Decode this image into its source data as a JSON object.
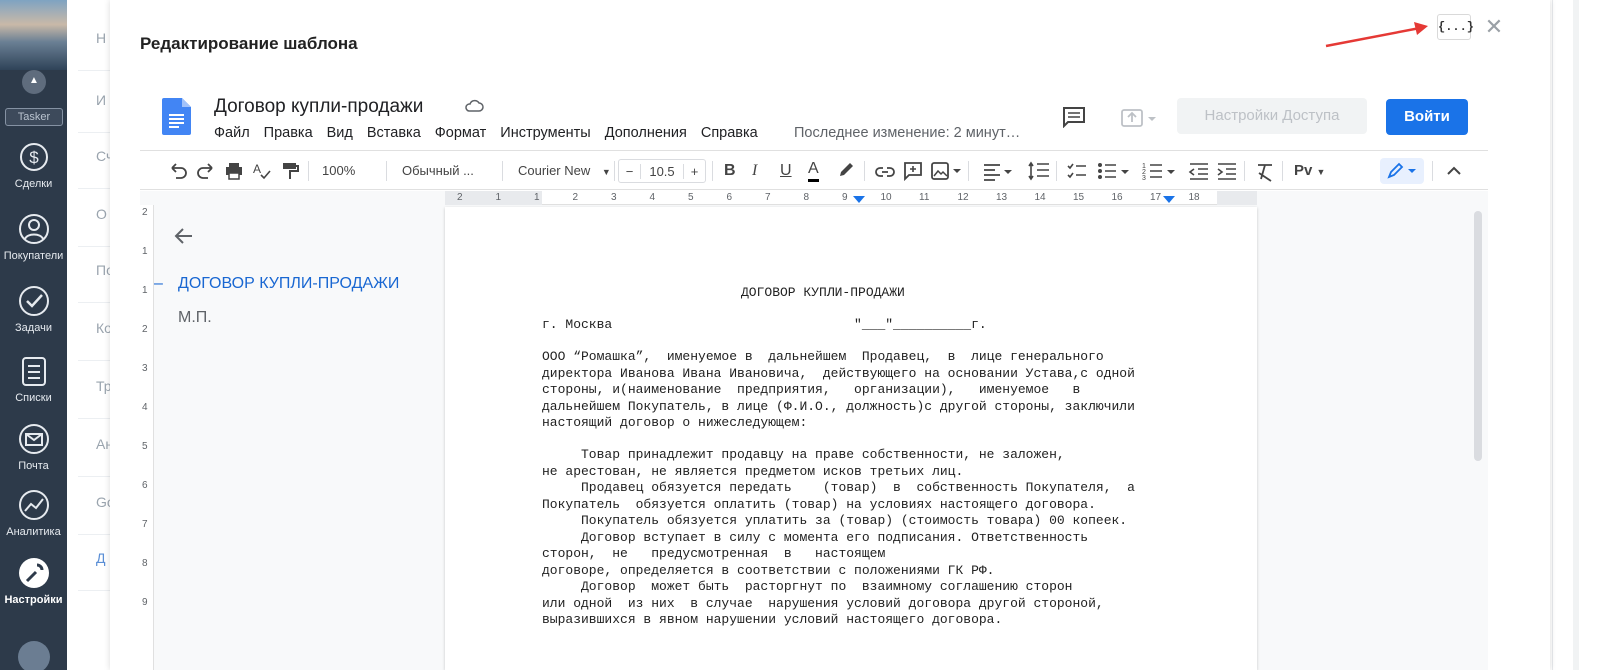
{
  "app": {
    "tasker_label": "Tasker",
    "nav": [
      {
        "label": "Сделки",
        "icon": "dollar-icon"
      },
      {
        "label": "Покупатели",
        "icon": "users-icon"
      },
      {
        "label": "Задачи",
        "icon": "check-icon"
      },
      {
        "label": "Списки",
        "icon": "list-icon"
      },
      {
        "label": "Почта",
        "icon": "mail-icon"
      },
      {
        "label": "Аналитика",
        "icon": "analytics-icon"
      },
      {
        "label": "Настройки",
        "icon": "wrench-icon",
        "active": true
      }
    ],
    "background_rows": [
      "Н",
      "И",
      "Сч",
      "О",
      "По",
      "Ко",
      "Тр",
      "Ан",
      "Go",
      "Д"
    ]
  },
  "modal": {
    "title": "Редактирование шаблона",
    "variables_button": "{...}",
    "close_label": "✕"
  },
  "docs": {
    "title": "Договор купли-продажи",
    "menus": [
      "Файл",
      "Правка",
      "Вид",
      "Вставка",
      "Формат",
      "Инструменты",
      "Дополнения",
      "Справка"
    ],
    "last_edit": "Последнее изменение: 2 минут…",
    "access_button": "Настройки Доступа",
    "login_button": "Войти",
    "accent_color": "#1a73e8"
  },
  "toolbar": {
    "zoom": "100%",
    "style": "Обычный ...",
    "font": "Courier New",
    "font_size": "10.5",
    "minus": "−",
    "plus": "+",
    "bold": "B",
    "italic": "I",
    "underline": "U",
    "text_color": "A",
    "input_tools": "Pv"
  },
  "ruler": {
    "h_ticks": [
      "2",
      "1",
      "1",
      "2",
      "3",
      "4",
      "5",
      "6",
      "7",
      "8",
      "9",
      "10",
      "11",
      "12",
      "13",
      "14",
      "15",
      "16",
      "17",
      "18"
    ],
    "v_ticks": [
      "2",
      "1",
      "1",
      "2",
      "3",
      "4",
      "5",
      "6",
      "7",
      "8",
      "9"
    ]
  },
  "outline": {
    "heading": "ДОГОВОР КУПЛИ-ПРОДАЖИ",
    "dash": "–",
    "item": "М.П."
  },
  "document": {
    "heading": "ДОГОВОР КУПЛИ-ПРОДАЖИ",
    "city_line": "г. Москва                               \"___\"__________г.",
    "paragraph1": [
      "ООО “Ромашка”,  именуемое в  дальнейшем  Продавец,  в  лице генерального",
      "директора Иванова Ивана Ивановича,  действующего на основании Устава,с одной",
      "стороны, и(наименование  предприятия,   организации),   именуемое   в",
      "дальнейшем Покупатель, в лице (Ф.И.О., должность)с другой стороны, заключили",
      "настоящий договор о нижеследующем:"
    ],
    "paragraph2": [
      "     Товар принадлежит продавцу на праве собственности, не заложен,",
      "не арестован, не является предметом исков третьих лиц.",
      "     Продавец обязуется передать    (товар)  в  собственность Покупателя,  а",
      "Покупатель  обязуется оплатить (товар) на условиях настоящего договора.",
      "     Покупатель обязуется уплатить за (товар) (стоимость товара) 00 копеек.",
      "     Договор вступает в силу с момента его подписания. Ответственность",
      "сторон,  не   предусмотренная  в   настоящем",
      "договоре, определяется в соответствии с положениями ГК РФ.",
      "     Договор  может быть  расторгнут по  взаимному соглашению сторон",
      "или одной  из них  в случае  нарушения условий договора другой стороной,",
      "выразившихся в явном нарушении условий настоящего договора."
    ]
  }
}
